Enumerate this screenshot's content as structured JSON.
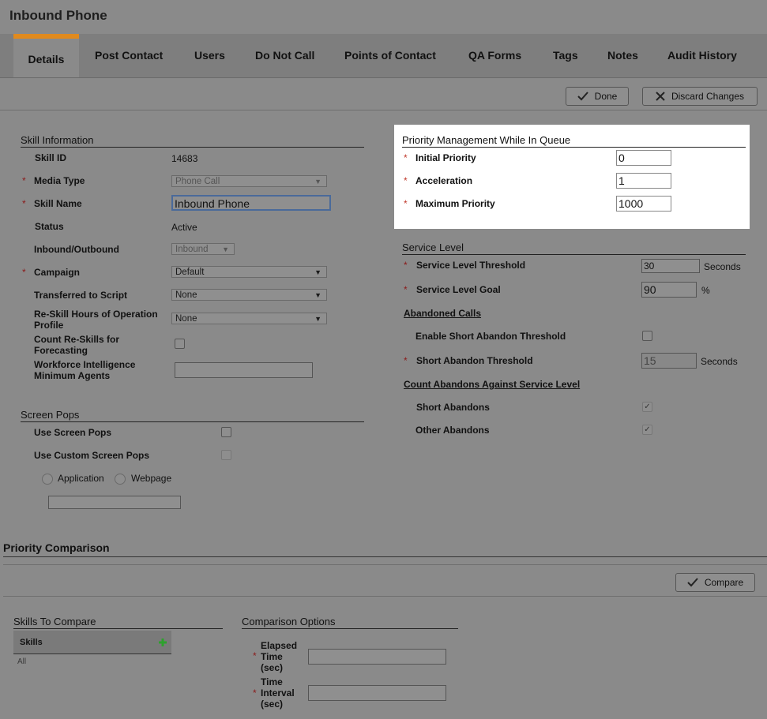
{
  "page": {
    "title": "Inbound Phone"
  },
  "tabs": [
    {
      "label": "Details"
    },
    {
      "label": "Post Contact"
    },
    {
      "label": "Users"
    },
    {
      "label": "Do Not Call"
    },
    {
      "label": "Points of Contact"
    },
    {
      "label": "QA Forms"
    },
    {
      "label": "Tags"
    },
    {
      "label": "Notes"
    },
    {
      "label": "Audit History"
    }
  ],
  "toolbar": {
    "done_label": "Done",
    "discard_label": "Discard Changes"
  },
  "skill_info": {
    "heading": "Skill Information",
    "skill_id_label": "Skill ID",
    "skill_id": "14683",
    "media_type_label": "Media Type",
    "media_type": "Phone Call",
    "skill_name_label": "Skill Name",
    "skill_name": "Inbound Phone",
    "status_label": "Status",
    "status": "Active",
    "inout_label": "Inbound/Outbound",
    "inout": "Inbound",
    "campaign_label": "Campaign",
    "campaign": "Default",
    "transferred_label": "Transferred to Script",
    "transferred": "None",
    "reskill_label_1": "Re-Skill Hours of Operation",
    "reskill_label_2": "Profile",
    "reskill": "None",
    "count_reskills_label_1": "Count Re-Skills for",
    "count_reskills_label_2": "Forecasting",
    "wfi_label_1": "Workforce Intelligence",
    "wfi_label_2": "Minimum Agents",
    "wfi_value": ""
  },
  "screen_pops": {
    "heading": "Screen Pops",
    "use_label": "Use Screen Pops",
    "custom_label": "Use Custom Screen Pops",
    "application_label": "Application",
    "webpage_label": "Webpage",
    "url_value": ""
  },
  "priority_mgmt": {
    "heading": "Priority Management While In Queue",
    "initial_label": "Initial Priority",
    "initial": "0",
    "accel_label": "Acceleration",
    "accel": "1",
    "max_label": "Maximum Priority",
    "max": "1000"
  },
  "service_level": {
    "heading": "Service Level",
    "threshold_label": "Service Level Threshold",
    "threshold": "30",
    "threshold_unit": "Seconds",
    "goal_label": "Service Level Goal",
    "goal": "90",
    "goal_unit": "%",
    "abandoned_heading": "Abandoned Calls",
    "enable_short_label": "Enable Short Abandon Threshold",
    "short_threshold_label": "Short Abandon Threshold",
    "short_threshold": "15",
    "short_unit": "Seconds",
    "count_heading": "Count Abandons Against Service Level",
    "short_abandons_label": "Short Abandons",
    "other_abandons_label": "Other Abandons"
  },
  "priority_comparison": {
    "heading": "Priority Comparison",
    "compare_label": "Compare",
    "skills_heading": "Skills To Compare",
    "skills_col": "Skills",
    "skills_all": "All",
    "options_heading": "Comparison Options",
    "elapsed_label_1": "Elapsed",
    "elapsed_label_2": "Time",
    "elapsed_label_3": "(sec)",
    "interval_label_1": "Time",
    "interval_label_2": "Interval",
    "interval_label_3": "(sec)"
  },
  "required_mark": "*",
  "colors": {
    "accent_tab": "#e08a1e",
    "required": "#8b1a1a",
    "add_icon": "#2ea12e"
  }
}
